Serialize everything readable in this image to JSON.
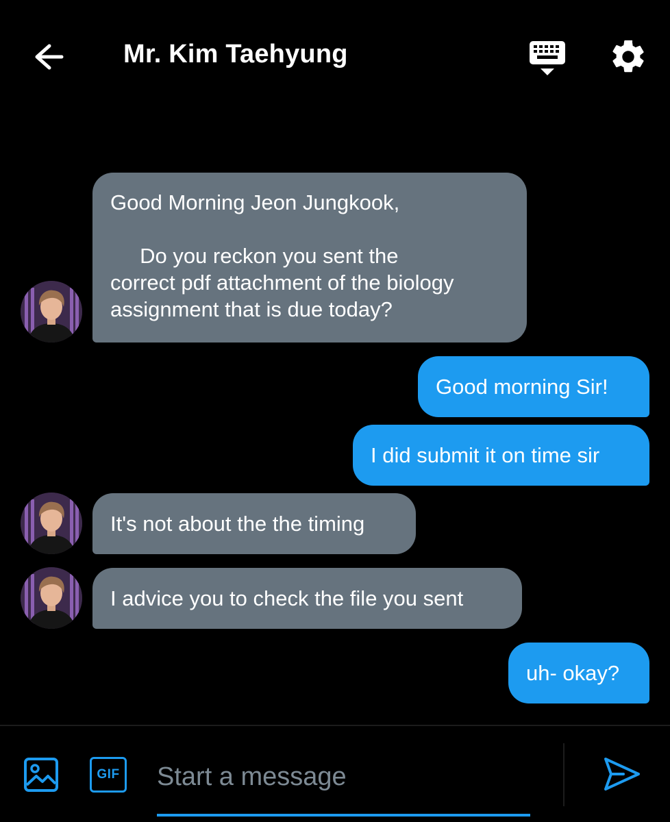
{
  "header": {
    "title": "Mr. Kim Taehyung"
  },
  "messages": [
    {
      "side": "received",
      "lines": [
        "Good Morning Jeon Jungkook,",
        "",
        "     Do you reckon you sent the",
        "correct pdf attachment of the biology",
        "assignment that is due today?"
      ]
    },
    {
      "side": "sent",
      "text": "Good morning Sir!"
    },
    {
      "side": "sent",
      "text": "I did submit it on time sir"
    },
    {
      "side": "received",
      "text": "It's not about the the timing"
    },
    {
      "side": "received",
      "text": "I advice you to check the file you sent"
    },
    {
      "side": "sent",
      "text": "uh- okay?"
    }
  ],
  "composer": {
    "placeholder": "Start a message",
    "gif_label": "GIF"
  },
  "icons": {
    "back": "arrow-left-icon",
    "keyboard": "keyboard-icon",
    "settings": "gear-icon",
    "image": "image-icon",
    "gif": "gif-icon",
    "send": "send-icon"
  },
  "colors": {
    "background": "#000000",
    "received_bubble": "#66737e",
    "sent_bubble": "#1d9bf0",
    "accent": "#1d9bf0",
    "placeholder": "#7d8a94"
  }
}
